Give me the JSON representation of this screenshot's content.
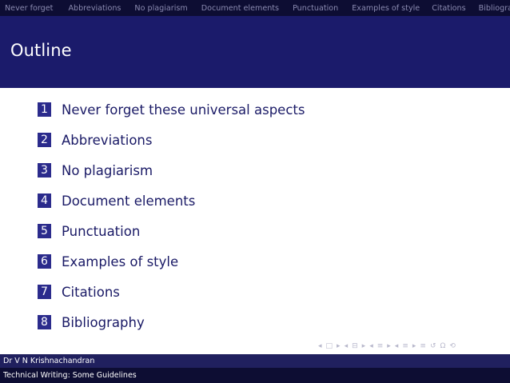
{
  "nav": {
    "items": [
      "Never forget",
      "Abbreviations",
      "No plagiarism",
      "Document elements",
      "Punctuation",
      "Examples of style",
      "Citations",
      "Bibliography"
    ]
  },
  "frame": {
    "title": "Outline"
  },
  "outline": [
    {
      "num": "1",
      "label": "Never forget these universal aspects"
    },
    {
      "num": "2",
      "label": "Abbreviations"
    },
    {
      "num": "3",
      "label": "No plagiarism"
    },
    {
      "num": "4",
      "label": "Document elements"
    },
    {
      "num": "5",
      "label": "Punctuation"
    },
    {
      "num": "6",
      "label": "Examples of style"
    },
    {
      "num": "7",
      "label": "Citations"
    },
    {
      "num": "8",
      "label": "Bibliography"
    }
  ],
  "controls": {
    "symbols": [
      "◂",
      "□",
      "▸",
      "◂",
      "⊟",
      "▸",
      "◂",
      "≡",
      "▸",
      "◂",
      "≡",
      "▸",
      "≡",
      "↺",
      "Ω",
      "⟲"
    ]
  },
  "footer": {
    "author": "Dr V N Krishnachandran",
    "presentation_title": "Technical Writing: Some Guidelines"
  }
}
